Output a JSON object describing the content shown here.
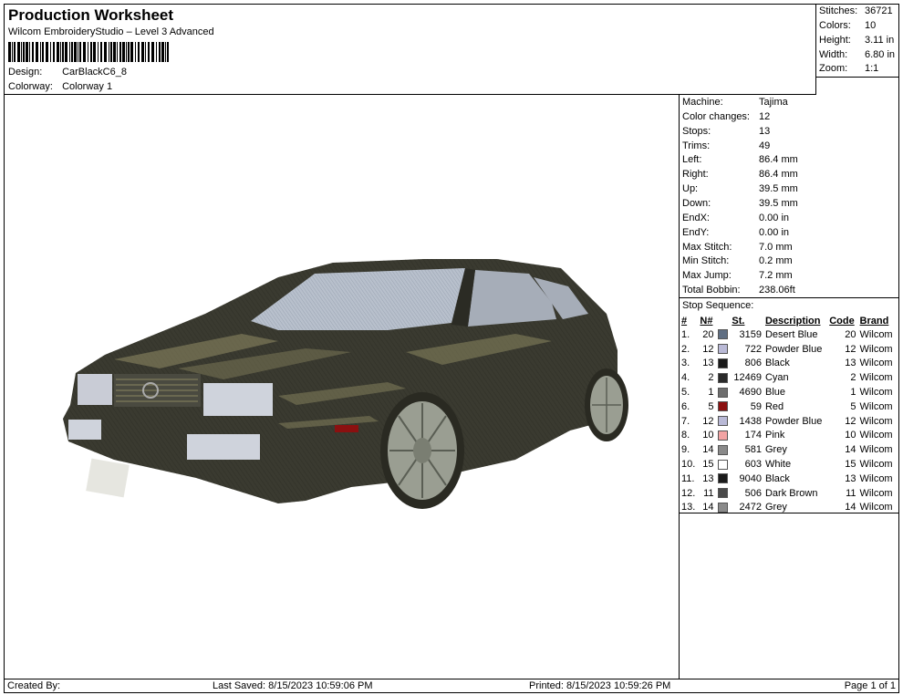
{
  "header": {
    "title": "Production Worksheet",
    "subtitle": "Wilcom EmbroideryStudio – Level 3 Advanced",
    "design_label": "Design:",
    "design_value": "CarBlackC6_8",
    "colorway_label": "Colorway:",
    "colorway_value": "Colorway 1"
  },
  "stats": [
    {
      "label": "Stitches:",
      "value": "36721"
    },
    {
      "label": "Colors:",
      "value": "10"
    },
    {
      "label": "Height:",
      "value": "3.11 in"
    },
    {
      "label": "Width:",
      "value": "6.80 in"
    },
    {
      "label": "Zoom:",
      "value": "1:1"
    }
  ],
  "properties": [
    {
      "label": "Machine:",
      "value": "Tajima"
    },
    {
      "label": "Color changes:",
      "value": "12"
    },
    {
      "label": "Stops:",
      "value": "13"
    },
    {
      "label": "Trims:",
      "value": "49"
    },
    {
      "label": "Left:",
      "value": "86.4 mm"
    },
    {
      "label": "Right:",
      "value": "86.4 mm"
    },
    {
      "label": "Up:",
      "value": "39.5 mm"
    },
    {
      "label": "Down:",
      "value": "39.5 mm"
    },
    {
      "label": "EndX:",
      "value": "0.00 in"
    },
    {
      "label": "EndY:",
      "value": "0.00 in"
    },
    {
      "label": "Max Stitch:",
      "value": "7.0 mm"
    },
    {
      "label": "Min Stitch:",
      "value": "0.2 mm"
    },
    {
      "label": "Max Jump:",
      "value": "7.2 mm"
    },
    {
      "label": "Total Bobbin:",
      "value": "238.06ft"
    }
  ],
  "stop_sequence": {
    "title": "Stop Sequence:",
    "headers": [
      "#",
      "N#",
      "St.",
      "Description",
      "Code",
      "Brand"
    ],
    "rows": [
      {
        "idx": "1.",
        "n": "20",
        "color": "#5f6e82",
        "st": "3159",
        "desc": "Desert Blue",
        "code": "20",
        "brand": "Wilcom"
      },
      {
        "idx": "2.",
        "n": "12",
        "color": "#b9b9d6",
        "st": "722",
        "desc": "Powder Blue",
        "code": "12",
        "brand": "Wilcom"
      },
      {
        "idx": "3.",
        "n": "13",
        "color": "#1a1a1a",
        "st": "806",
        "desc": "Black",
        "code": "13",
        "brand": "Wilcom"
      },
      {
        "idx": "4.",
        "n": "2",
        "color": "#2a2a2a",
        "st": "12469",
        "desc": "Cyan",
        "code": "2",
        "brand": "Wilcom"
      },
      {
        "idx": "5.",
        "n": "1",
        "color": "#6e6e6e",
        "st": "4690",
        "desc": "Blue",
        "code": "1",
        "brand": "Wilcom"
      },
      {
        "idx": "6.",
        "n": "5",
        "color": "#8b1010",
        "st": "59",
        "desc": "Red",
        "code": "5",
        "brand": "Wilcom"
      },
      {
        "idx": "7.",
        "n": "12",
        "color": "#b9b9d6",
        "st": "1438",
        "desc": "Powder Blue",
        "code": "12",
        "brand": "Wilcom"
      },
      {
        "idx": "8.",
        "n": "10",
        "color": "#f2a3a3",
        "st": "174",
        "desc": "Pink",
        "code": "10",
        "brand": "Wilcom"
      },
      {
        "idx": "9.",
        "n": "14",
        "color": "#8a8a8a",
        "st": "581",
        "desc": "Grey",
        "code": "14",
        "brand": "Wilcom"
      },
      {
        "idx": "10.",
        "n": "15",
        "color": "#ffffff",
        "st": "603",
        "desc": "White",
        "code": "15",
        "brand": "Wilcom"
      },
      {
        "idx": "11.",
        "n": "13",
        "color": "#1a1a1a",
        "st": "9040",
        "desc": "Black",
        "code": "13",
        "brand": "Wilcom"
      },
      {
        "idx": "12.",
        "n": "11",
        "color": "#4a4a4a",
        "st": "506",
        "desc": "Dark Brown",
        "code": "11",
        "brand": "Wilcom"
      },
      {
        "idx": "13.",
        "n": "14",
        "color": "#8a8a8a",
        "st": "2472",
        "desc": "Grey",
        "code": "14",
        "brand": "Wilcom"
      }
    ]
  },
  "footer": {
    "created_by": "Created By:",
    "last_saved": "Last Saved: 8/15/2023 10:59:06 PM",
    "printed": "Printed: 8/15/2023 10:59:26 PM",
    "page": "Page 1 of 1"
  },
  "colors": {
    "car_body": "#3a3a30",
    "car_highlight": "#8a8660",
    "glass": "#b8c0cc",
    "wheel": "#9a9e92"
  }
}
